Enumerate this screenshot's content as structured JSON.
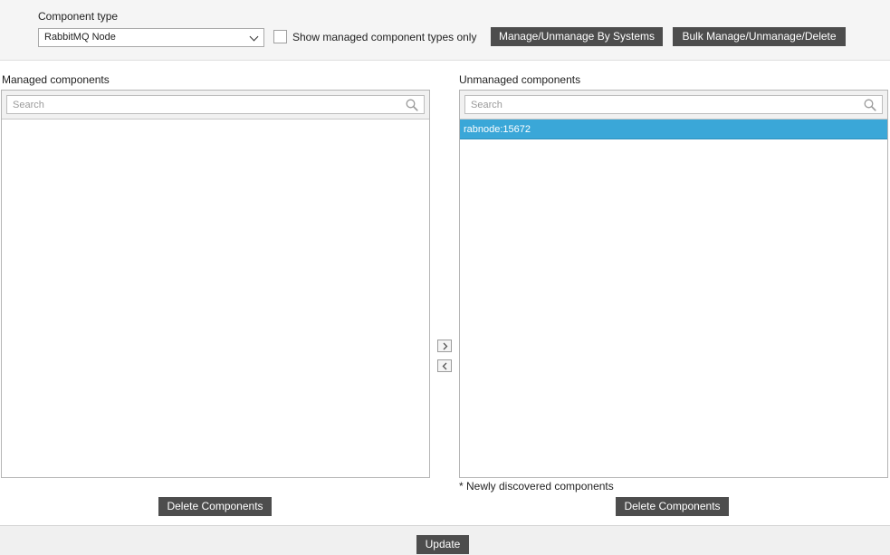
{
  "header": {
    "component_type_label": "Component type",
    "component_type_value": "RabbitMQ Node",
    "show_managed_label": "Show managed component types only",
    "show_managed_checked": false,
    "manage_by_systems_label": "Manage/Unmanage By Systems",
    "bulk_label": "Bulk Manage/Unmanage/Delete"
  },
  "managed": {
    "title": "Managed components",
    "search_placeholder": "Search",
    "items": [],
    "delete_label": "Delete Components"
  },
  "unmanaged": {
    "title": "Unmanaged components",
    "search_placeholder": "Search",
    "items": [
      {
        "label": "rabnode:15672",
        "selected": true
      }
    ],
    "note": "* Newly discovered components",
    "delete_label": "Delete Components"
  },
  "footer": {
    "update_label": "Update"
  },
  "colors": {
    "button_bg": "#4d4d4d",
    "selected_row": "#3aa7d8",
    "header_bg": "#f5f5f5"
  },
  "icons": {
    "search": "search-icon",
    "move_right": "chevron-right-icon",
    "move_left": "chevron-left-icon",
    "dropdown": "chevron-down-icon"
  }
}
